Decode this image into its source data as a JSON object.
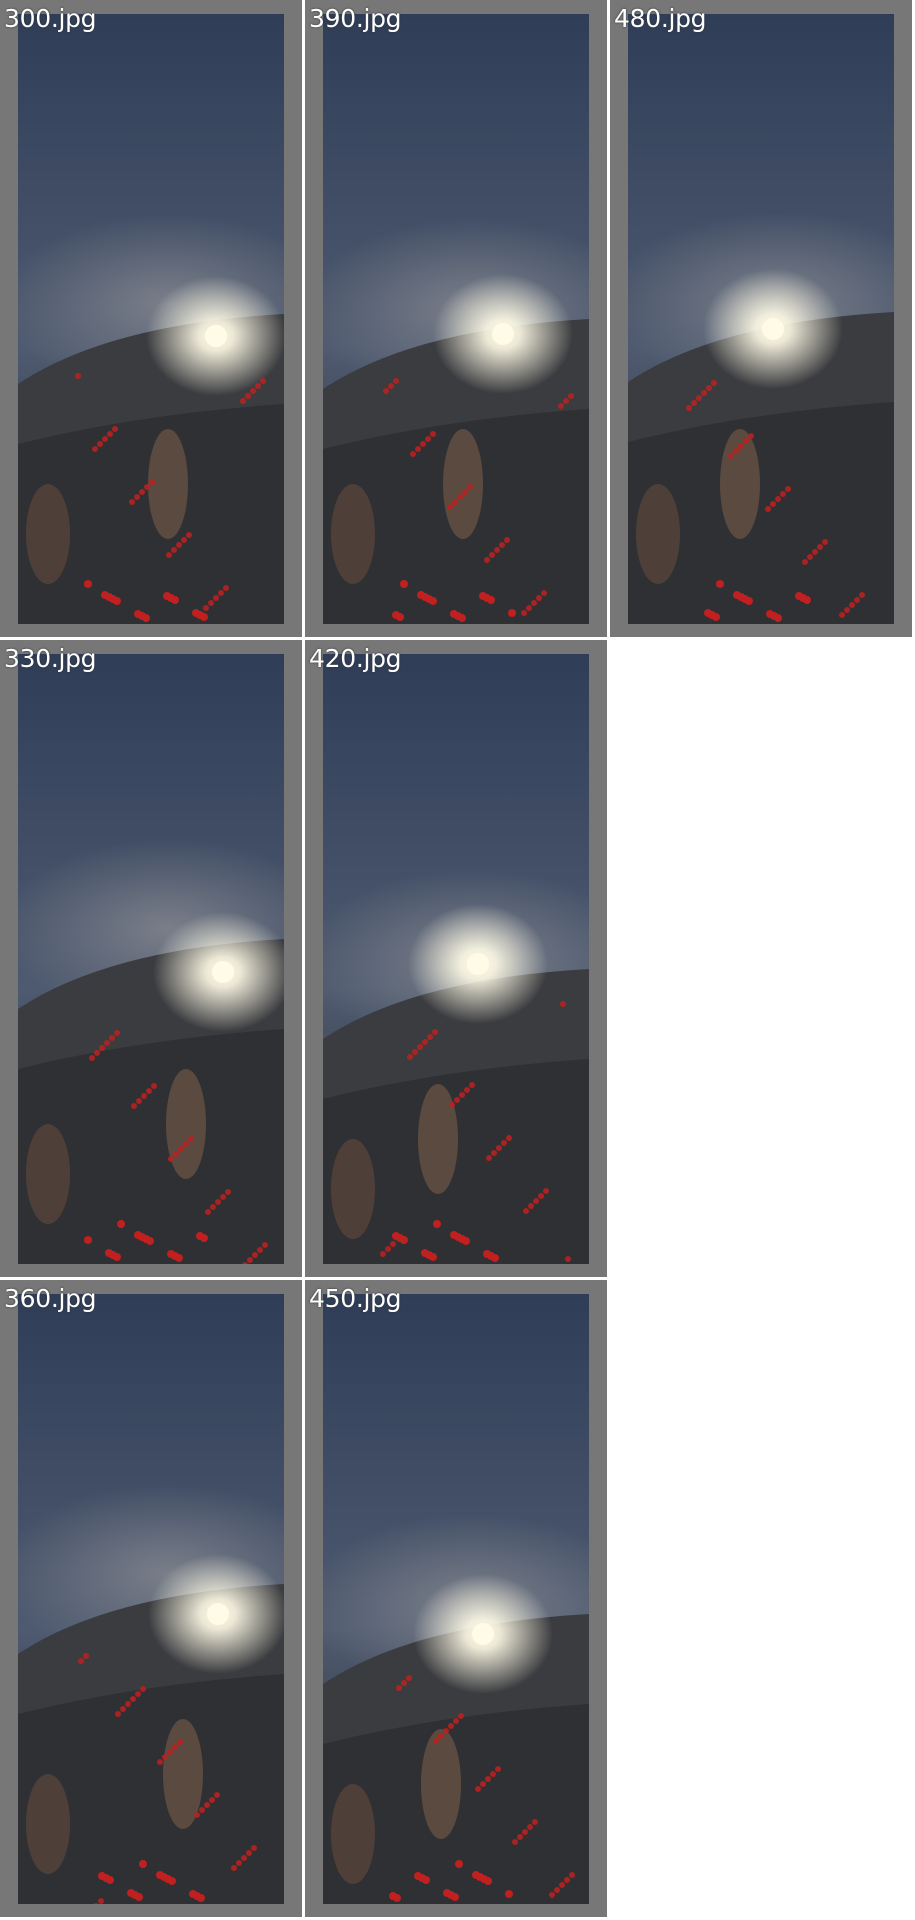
{
  "gallery": {
    "tiles": [
      {
        "filename": "300.jpg"
      },
      {
        "filename": "390.jpg"
      },
      {
        "filename": "480.jpg"
      },
      {
        "filename": "330.jpg"
      },
      {
        "filename": "420.jpg"
      },
      {
        "filename": "360.jpg"
      },
      {
        "filename": "450.jpg"
      }
    ]
  },
  "colors": {
    "frame": "#777777",
    "background": "#ffffff",
    "sky_top": "#2f3d57",
    "sky_bottom": "#4e5a70",
    "fog": "#8a8c92",
    "lamp": "#fffbe6",
    "crowd_red": "#c02020"
  }
}
